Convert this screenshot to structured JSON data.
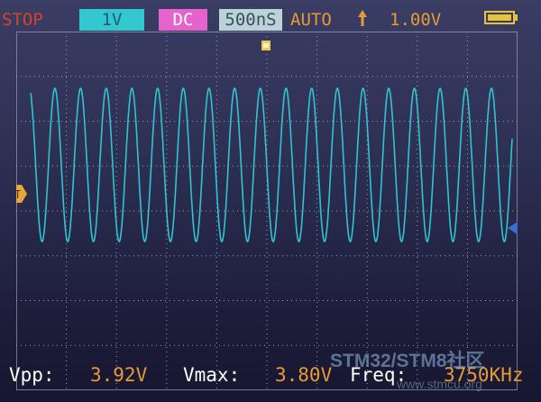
{
  "top_bar": {
    "run_state": "STOP",
    "volts_per_div": "1V",
    "coupling": "DC",
    "time_per_div": "500nS",
    "trigger_mode": "AUTO",
    "trigger_edge_icon": "rising-edge-arrow-icon",
    "trigger_level": "1.00V",
    "battery_icon": "battery-full-icon"
  },
  "colors": {
    "trace": "#2fc4cf",
    "grid": "#9a9ab4",
    "marker": "#e8a73a",
    "value_text": "#e79a36",
    "label_text": "#ffffff",
    "run_state": "#d7422c",
    "volts_badge": "#33c7d0",
    "coupling_badge": "#e463cd",
    "time_badge": "#b9d3d9"
  },
  "markers": {
    "trigger_marker_label": "T",
    "trigger_marker_icon": "trigger-level-marker-icon",
    "ground_marker_icon": "channel-ground-marker-icon",
    "trigger_position_icon": "trigger-position-marker-icon"
  },
  "measurements": {
    "vpp_label": "Vpp:",
    "vpp_value": "3.92V",
    "vmax_label": "Vmax:",
    "vmax_value": "3.80V",
    "freq_label": "Freq:",
    "freq_value": "3750KHz"
  },
  "watermark": {
    "title": "STM32/STM8社区",
    "url": "www.stmcu.org"
  },
  "waveform": {
    "type": "sine",
    "cycles_on_screen": 18.75,
    "frequency": "3750KHz",
    "vpp": 3.92,
    "vmax": 3.8
  }
}
